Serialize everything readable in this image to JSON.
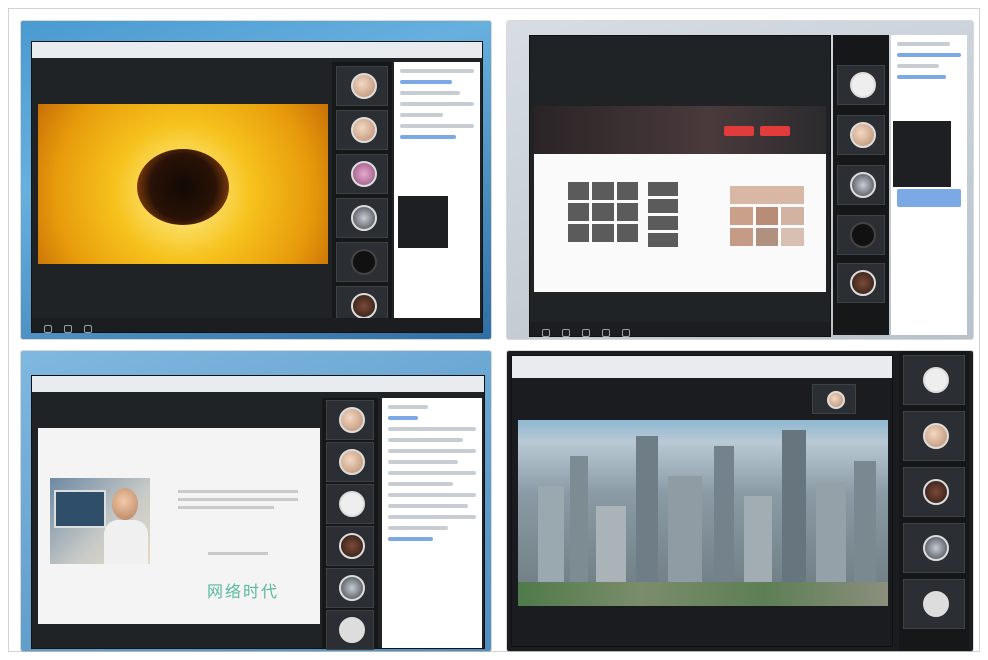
{
  "panels": [
    {
      "id": "top-left",
      "window_title": "",
      "tiles": [
        "",
        "",
        "",
        "",
        "",
        ""
      ]
    },
    {
      "id": "top-right",
      "window_title": "",
      "banner_text": "",
      "tiles": [
        "",
        "",
        "",
        "",
        "",
        ""
      ]
    },
    {
      "id": "bottom-left",
      "window_title": "",
      "slide_title": "网络时代",
      "tiles": [
        "",
        "",
        "",
        "",
        "",
        ""
      ]
    },
    {
      "id": "bottom-right",
      "window_title": "",
      "tiles": [
        "",
        "",
        "",
        "",
        ""
      ]
    }
  ],
  "colors": {
    "slide_title": "#5ab8a1",
    "dark_ui": "#202326",
    "accent_red": "#e23b3b"
  }
}
